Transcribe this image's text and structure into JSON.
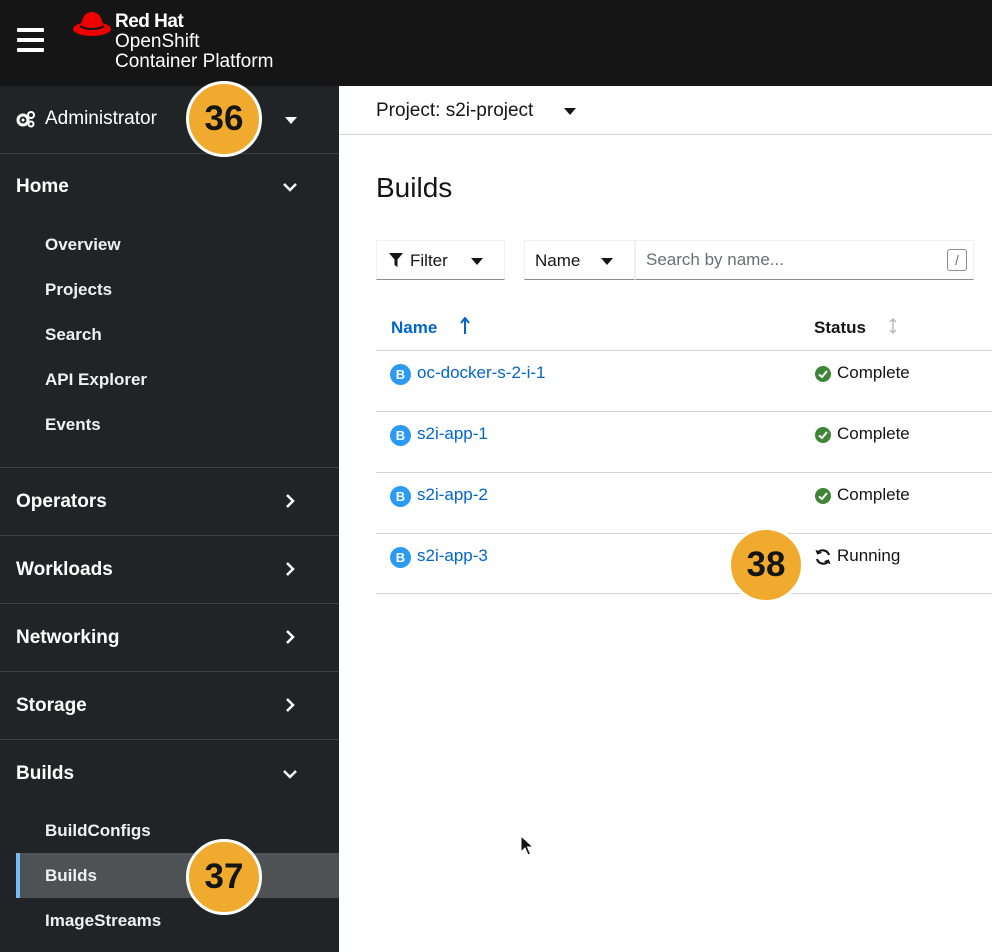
{
  "masthead": {
    "brand": "Red Hat",
    "product_line1": "OpenShift",
    "product_line2": "Container Platform",
    "hamburger_icon": "bars-icon",
    "background": "#151515"
  },
  "sidebar": {
    "perspective": {
      "label": "Administrator",
      "icon": "cogs-icon"
    },
    "sections": [
      {
        "label": "Home",
        "expanded": true,
        "items": [
          "Overview",
          "Projects",
          "Search",
          "API Explorer",
          "Events"
        ]
      },
      {
        "label": "Operators",
        "expanded": false
      },
      {
        "label": "Workloads",
        "expanded": false
      },
      {
        "label": "Networking",
        "expanded": false
      },
      {
        "label": "Storage",
        "expanded": false
      },
      {
        "label": "Builds",
        "expanded": true,
        "items": [
          "BuildConfigs",
          "Builds",
          "ImageStreams"
        ],
        "active_item": "Builds"
      }
    ],
    "background": "#212427",
    "active_accent": "#73bcf7"
  },
  "main": {
    "project_label": "Project: s2i-project",
    "page_title": "Builds",
    "toolbar": {
      "filter_label": "Filter",
      "filter_type_label": "Name",
      "search_placeholder": "Search by name...",
      "search_shortcut": "/"
    },
    "table": {
      "columns": [
        "Name",
        "Status"
      ],
      "rows": [
        {
          "icon_letter": "B",
          "name": "oc-docker-s-2-i-1",
          "status": "Complete",
          "status_icon": "check-circle-icon"
        },
        {
          "icon_letter": "B",
          "name": "s2i-app-1",
          "status": "Complete",
          "status_icon": "check-circle-icon"
        },
        {
          "icon_letter": "B",
          "name": "s2i-app-2",
          "status": "Complete",
          "status_icon": "check-circle-icon"
        },
        {
          "icon_letter": "B",
          "name": "s2i-app-3",
          "status": "Running",
          "status_icon": "sync-icon"
        }
      ]
    },
    "link_color": "#0066cc",
    "success_color": "#3e8635"
  },
  "callouts": {
    "perspective": "36",
    "builds_nav": "37",
    "running_status": "38",
    "color": "#f0ab2f"
  }
}
